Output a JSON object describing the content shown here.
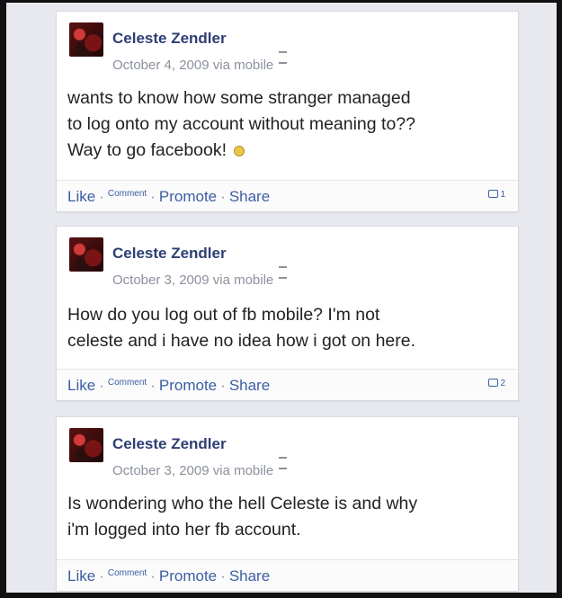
{
  "posts": [
    {
      "author": "Celeste Zendler",
      "meta": "October 4, 2009 via mobile",
      "text_lines": [
        "wants to know how some stranger managed",
        "to log onto my account without meaning to??",
        "Way to go facebook!"
      ],
      "has_smiley": true,
      "comment_count": "1"
    },
    {
      "author": "Celeste Zendler",
      "meta": "October 3, 2009 via mobile",
      "text_lines": [
        "How do you log out of fb mobile? I'm not",
        "celeste and i have no idea how i got on here."
      ],
      "has_smiley": false,
      "comment_count": "2"
    },
    {
      "author": "Celeste Zendler",
      "meta": "October 3, 2009 via mobile",
      "text_lines": [
        "Is wondering who the hell Celeste is and why",
        "i'm logged into her fb account."
      ],
      "has_smiley": false,
      "comment_count": ""
    }
  ],
  "actions": {
    "like": "Like",
    "comment": "Comment",
    "promote": "Promote",
    "share": "Share",
    "sep": "·"
  },
  "icons": {
    "mobile": "mobile-phone-icon",
    "comment_bubble": "comment-bubble-icon",
    "smiley": "sad-face-icon"
  },
  "colors": {
    "link": "#3b5ea2",
    "name": "#2d3e73",
    "meta": "#8b919c"
  }
}
